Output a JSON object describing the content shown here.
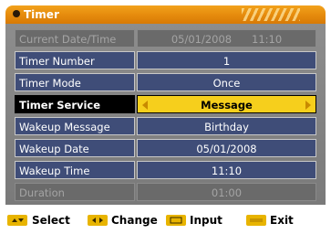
{
  "title": "Timer",
  "rows": [
    {
      "label": "Current Date/Time",
      "value": "05/01/2008      11:10"
    },
    {
      "label": "Timer Number",
      "value": "1"
    },
    {
      "label": "Timer Mode",
      "value": "Once"
    },
    {
      "label": "Timer Service",
      "value": "Message"
    },
    {
      "label": "Wakeup Message",
      "value": "Birthday"
    },
    {
      "label": "Wakeup Date",
      "value": "05/01/2008"
    },
    {
      "label": "Wakeup Time",
      "value": "11:10"
    },
    {
      "label": "Duration",
      "value": "01:00"
    }
  ],
  "footer": {
    "select": "Select",
    "change": "Change",
    "input": "Input",
    "exit": "Exit"
  },
  "colors": {
    "title_bar": "#e58a0c",
    "row_bg": "#3f4d78",
    "selected_value": "#f6cf1c",
    "key_badge": "#e8b400"
  }
}
